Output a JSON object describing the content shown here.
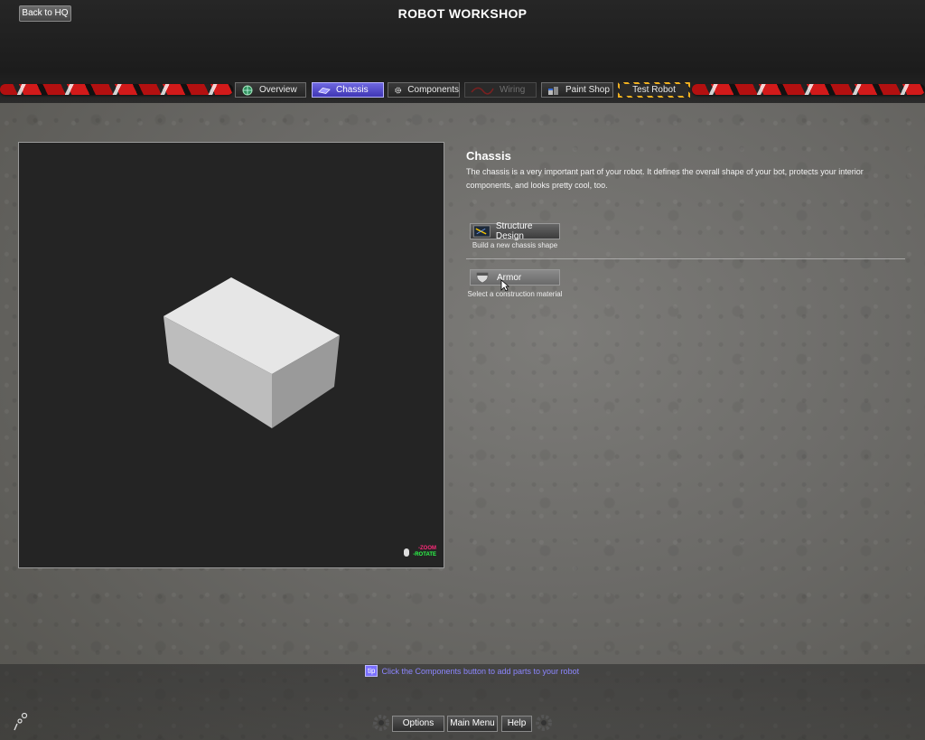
{
  "header": {
    "back_label": "Back to HQ",
    "title": "ROBOT WORKSHOP"
  },
  "tabs": [
    {
      "label": "Overview",
      "icon": "globe-icon",
      "state": "normal"
    },
    {
      "label": "Chassis",
      "icon": "chassis-icon",
      "state": "active"
    },
    {
      "label": "Components",
      "icon": "gear-icon",
      "state": "normal"
    },
    {
      "label": "Wiring",
      "icon": "wire-icon",
      "state": "disabled"
    },
    {
      "label": "Paint Shop",
      "icon": "paint-cans-icon",
      "state": "normal"
    },
    {
      "label": "Test Robot",
      "icon": "hazard-stripes",
      "state": "normal"
    }
  ],
  "viewport": {
    "zoom_label": "ZOOM",
    "rotate_label": "ROTATE"
  },
  "info": {
    "title": "Chassis",
    "description": "The chassis is a very important part of your robot. It defines the overall shape of your bot, protects your interior components, and looks pretty cool, too."
  },
  "actions": [
    {
      "label": "Structure Design",
      "caption": "Build a new chassis shape",
      "icon": "blueprint-icon"
    },
    {
      "label": "Armor",
      "caption": "Select a construction material",
      "icon": "shield-icon"
    }
  ],
  "tip": {
    "badge": "tip",
    "text": "Click the Components button to add parts to your robot"
  },
  "footer": {
    "options_label": "Options",
    "main_menu_label": "Main Menu",
    "help_label": "Help"
  },
  "colors": {
    "active_tab": "#4b42c8",
    "tip_text": "#8c86ff",
    "zoom": "#ff2a7a",
    "rotate": "#2cff4a",
    "viewport_bg": "#242424"
  }
}
